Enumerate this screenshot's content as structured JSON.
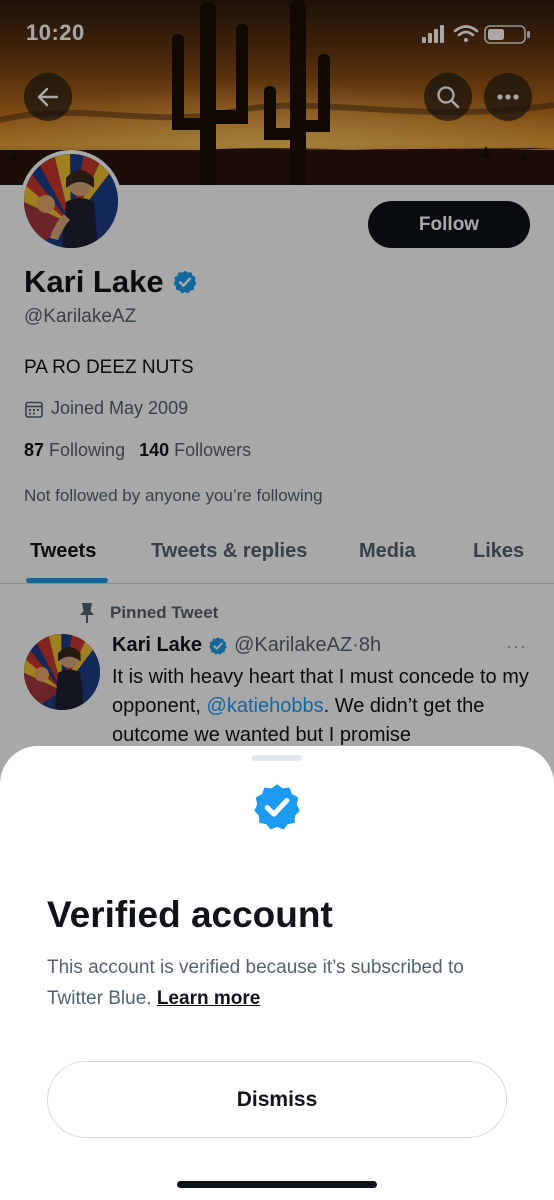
{
  "status_bar": {
    "time": "10:20"
  },
  "header": {
    "back_icon": "back-arrow-icon",
    "search_icon": "search-icon",
    "more_icon": "more-horizontal-icon"
  },
  "profile": {
    "name": "Kari Lake",
    "handle": "@KarilakeAZ",
    "bio": "PA RO DEEZ NUTS",
    "joined": "Joined May 2009",
    "following_count": "87",
    "following_label": "Following",
    "followers_count": "140",
    "followers_label": "Followers",
    "not_followed_text": "Not followed by anyone you’re following",
    "follow_label": "Follow"
  },
  "tabs": [
    {
      "label": "Tweets",
      "active": true
    },
    {
      "label": "Tweets & replies",
      "active": false
    },
    {
      "label": "Media",
      "active": false
    },
    {
      "label": "Likes",
      "active": false
    }
  ],
  "tweet": {
    "pinned_label": "Pinned Tweet",
    "author_name": "Kari Lake",
    "author_handle": "@KarilakeAZ",
    "separator": "·",
    "time": "8h",
    "more": "···",
    "text_before": "It is with heavy heart that I must concede to my opponent, ",
    "mention": "@katiehobbs",
    "text_after": ". We didn’t get the outcome we wanted but I promise"
  },
  "sheet": {
    "title": "Verified account",
    "body": "This account is verified because it’s subscribed to Twitter Blue. ",
    "learn_more": "Learn more",
    "dismiss_label": "Dismiss"
  },
  "colors": {
    "accent": "#1d9bf0",
    "verified_badge": "#1d9bf0",
    "text_primary": "#0f1419",
    "text_secondary": "#536471",
    "follow_button": "#0f1419"
  }
}
